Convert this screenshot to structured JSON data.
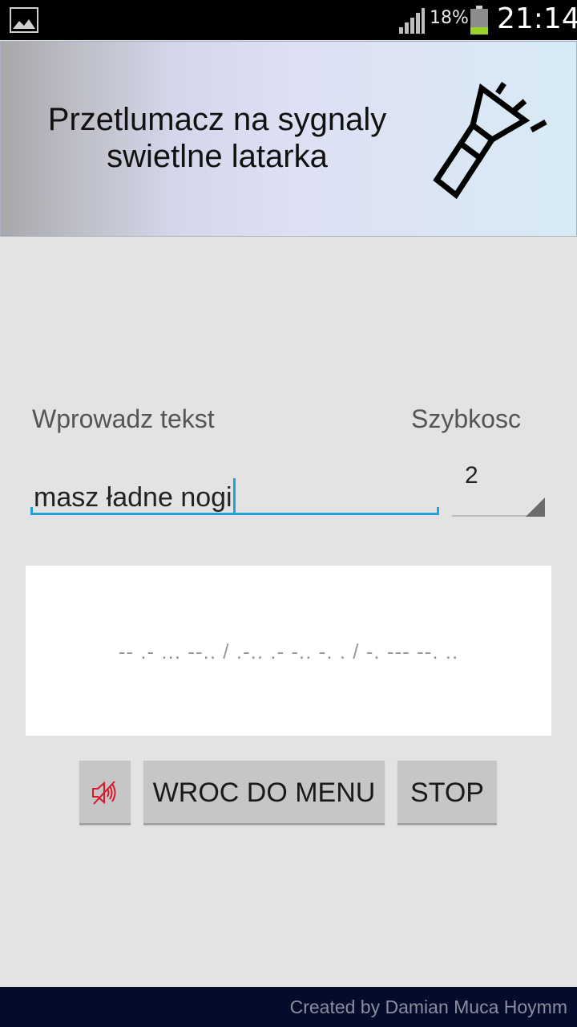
{
  "status_bar": {
    "battery_percent": "18%",
    "time": "21:14",
    "icons": [
      "gallery-notification-icon",
      "signal-icon",
      "battery-icon"
    ]
  },
  "banner": {
    "title_line1": "Przetlumacz na sygnaly",
    "title_line2": "swietlne latarka",
    "icon": "flashlight-icon"
  },
  "form": {
    "text_label": "Wprowadz tekst",
    "speed_label": "Szybkosc",
    "text_value": "masz ładne nogi",
    "speed_value": "2"
  },
  "output": {
    "morse": "-- .- ... --.. / .-.. .- -.. -. . / -. --- --. .."
  },
  "buttons": {
    "mute_icon": "sound-off-icon",
    "menu_label": "WROC DO MENU",
    "stop_label": "STOP"
  },
  "footer": {
    "credit": "Created by Damian Muca Hoymm"
  },
  "colors": {
    "accent": "#22a3d8",
    "mute_icon": "#d8192a",
    "footer_bg": "#050b2a"
  }
}
